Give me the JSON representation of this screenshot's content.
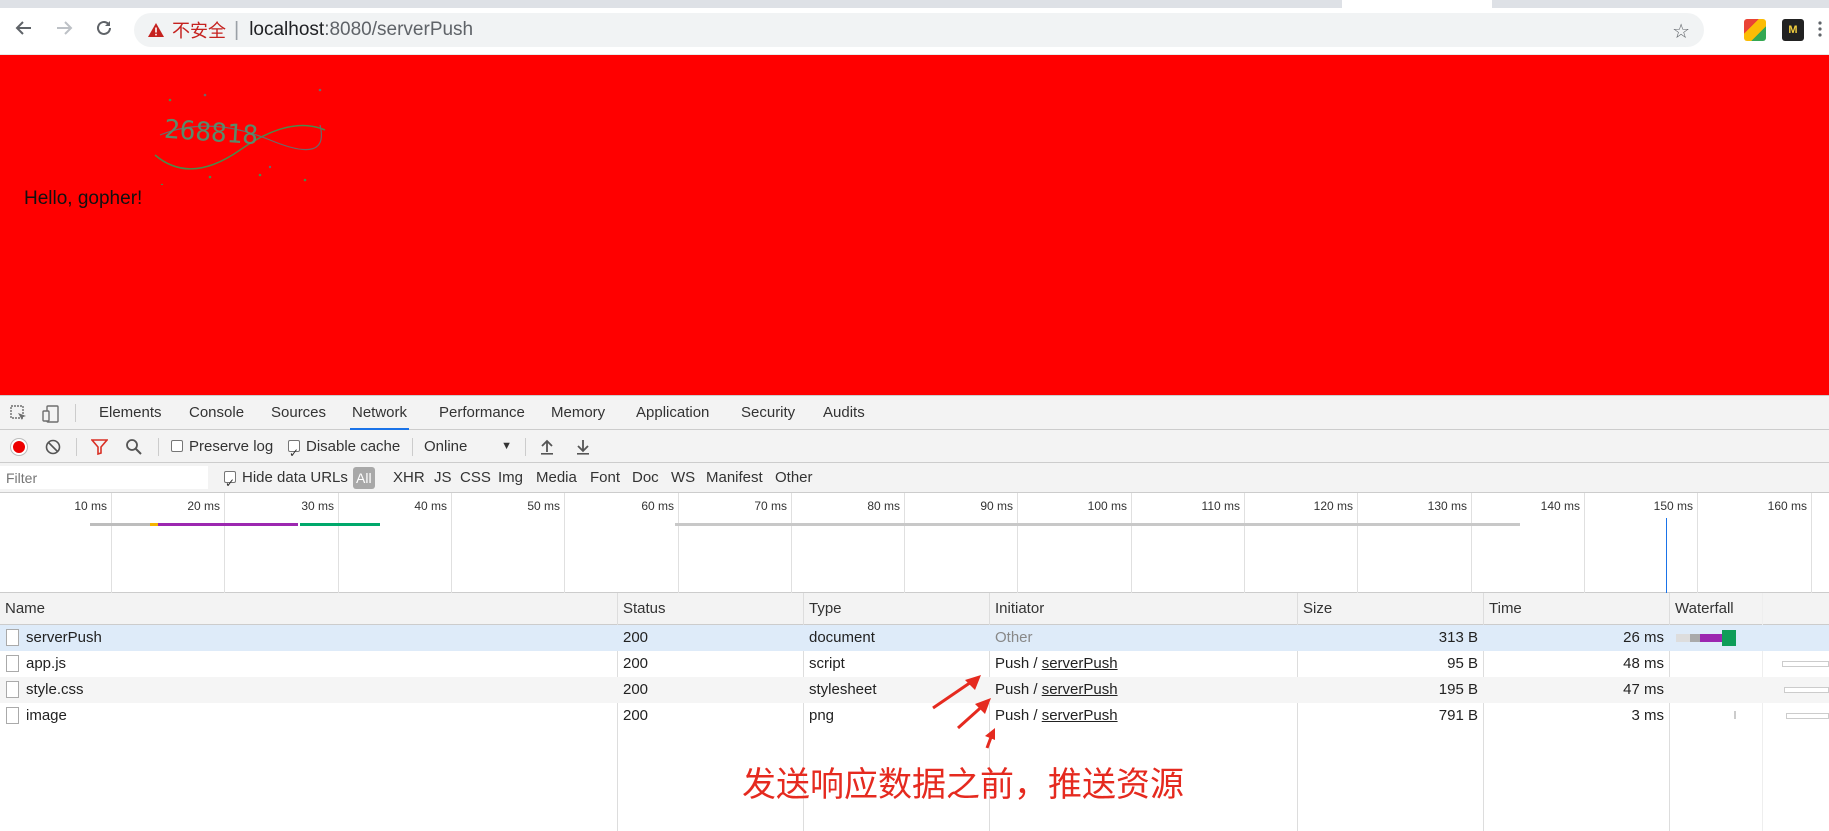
{
  "browser": {
    "security_label": "不安全",
    "separator": "|",
    "url_host": "localhost",
    "url_rest": ":8080/serverPush"
  },
  "page": {
    "captcha_text": "268818",
    "greeting": "Hello, gopher!",
    "background": "#ff0000"
  },
  "devtools": {
    "tabs": [
      "Elements",
      "Console",
      "Sources",
      "Network",
      "Performance",
      "Memory",
      "Application",
      "Security",
      "Audits"
    ],
    "active_tab": "Network",
    "toolbar": {
      "preserve_log": "Preserve log",
      "disable_cache": "Disable cache",
      "throttle": "Online"
    },
    "filterbar": {
      "filter_placeholder": "Filter",
      "hide_data_urls": "Hide data URLs",
      "types": [
        "All",
        "XHR",
        "JS",
        "CSS",
        "Img",
        "Media",
        "Font",
        "Doc",
        "WS",
        "Manifest",
        "Other"
      ]
    },
    "overview_ticks": [
      "10 ms",
      "20 ms",
      "30 ms",
      "40 ms",
      "50 ms",
      "60 ms",
      "70 ms",
      "80 ms",
      "90 ms",
      "100 ms",
      "110 ms",
      "120 ms",
      "130 ms",
      "140 ms",
      "150 ms",
      "160 ms"
    ],
    "columns": {
      "name": "Name",
      "status": "Status",
      "type": "Type",
      "initiator": "Initiator",
      "size": "Size",
      "time": "Time",
      "waterfall": "Waterfall"
    },
    "rows": [
      {
        "name": "serverPush",
        "status": "200",
        "type": "document",
        "initiator_prefix": "",
        "initiator_link": "",
        "initiator_plain": "Other",
        "size": "313 B",
        "time": "26 ms"
      },
      {
        "name": "app.js",
        "status": "200",
        "type": "script",
        "initiator_prefix": "Push / ",
        "initiator_link": "serverPush",
        "initiator_plain": "",
        "size": "95 B",
        "time": "48 ms"
      },
      {
        "name": "style.css",
        "status": "200",
        "type": "stylesheet",
        "initiator_prefix": "Push / ",
        "initiator_link": "serverPush",
        "initiator_plain": "",
        "size": "195 B",
        "time": "47 ms"
      },
      {
        "name": "image",
        "status": "200",
        "type": "png",
        "initiator_prefix": "Push / ",
        "initiator_link": "serverPush",
        "initiator_plain": "",
        "size": "791 B",
        "time": "3 ms"
      }
    ]
  },
  "annotation": "发送响应数据之前，推送资源",
  "colors": {
    "accent": "#1a73e8",
    "annotation": "#e52a1f",
    "record": "#ee0000"
  }
}
